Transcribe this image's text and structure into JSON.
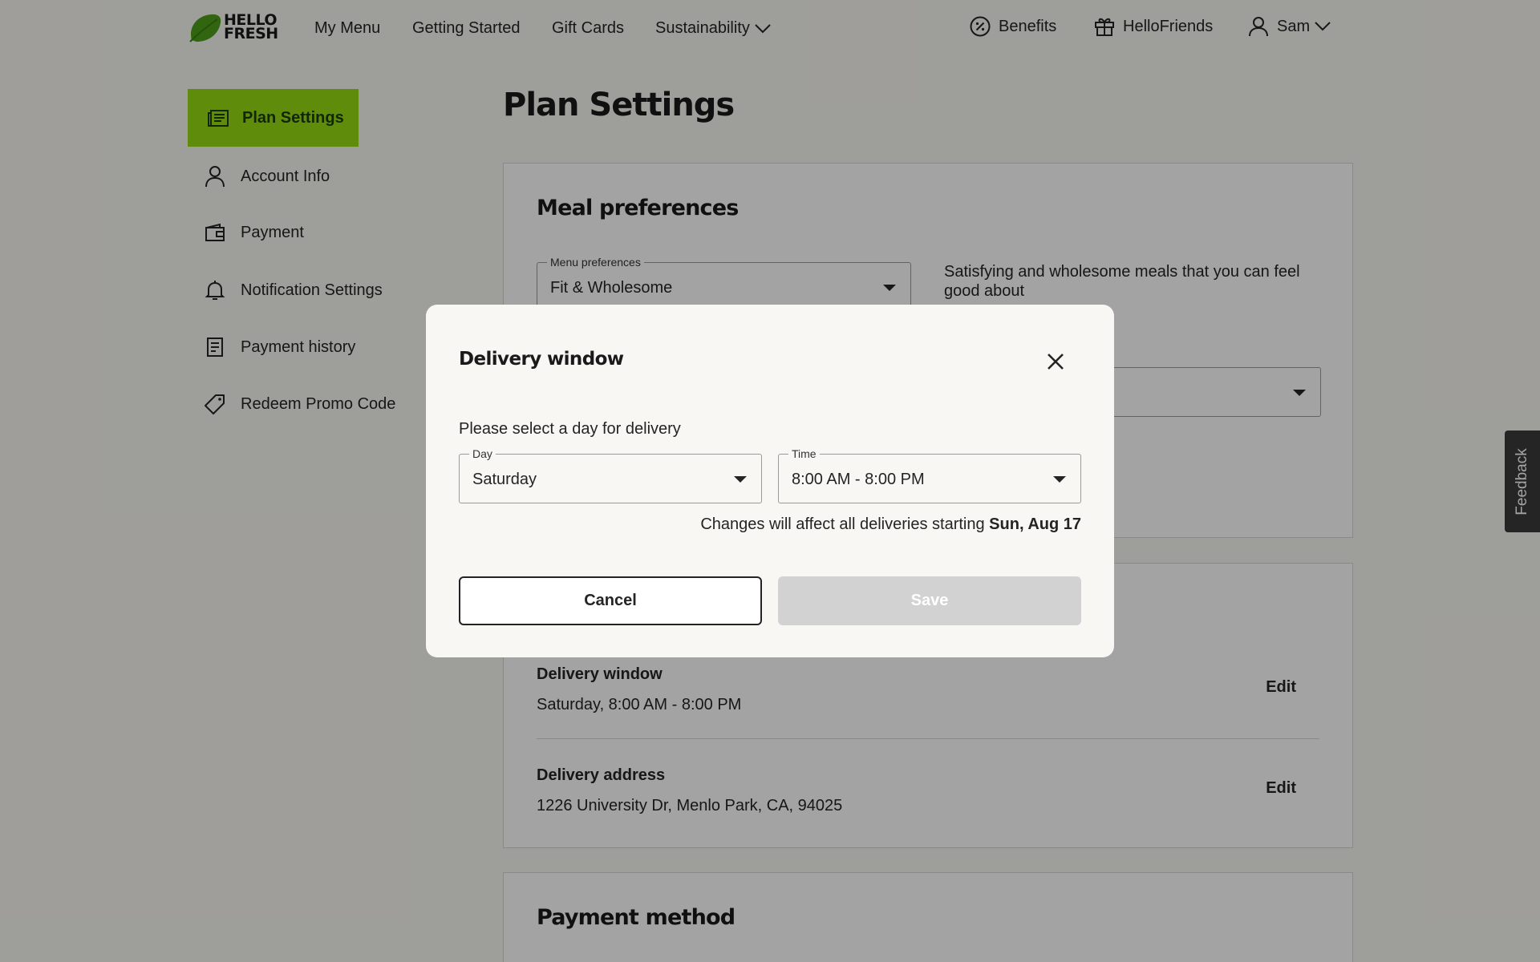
{
  "header": {
    "logo_line1": "HELLO",
    "logo_line2": "FRESH",
    "nav": [
      "My Menu",
      "Getting Started",
      "Gift Cards",
      "Sustainability"
    ],
    "benefits": "Benefits",
    "hellofriends": "HelloFriends",
    "user": "Sam"
  },
  "sidebar": {
    "active": "Plan Settings",
    "items": [
      "Account Info",
      "Payment",
      "Notification Settings",
      "Payment history",
      "Redeem Promo Code"
    ]
  },
  "main": {
    "title": "Plan Settings",
    "meal_card": {
      "title": "Meal preferences",
      "menu_pref_legend": "Menu preferences",
      "menu_pref_value": "Fit & Wholesome",
      "menu_pref_desc": "Satisfying and wholesome meals that you can feel good about"
    },
    "delivery_card": {
      "window_label": "Delivery window",
      "window_value": "Saturday, 8:00 AM - 8:00 PM",
      "address_label": "Delivery address",
      "address_value": "1226 University Dr, Menlo Park, CA, 94025",
      "edit": "Edit"
    },
    "payment_card": {
      "title": "Payment method"
    }
  },
  "feedback": "Feedback",
  "modal": {
    "title": "Delivery window",
    "prompt": "Please select a day for delivery",
    "day_legend": "Day",
    "day_value": "Saturday",
    "time_legend": "Time",
    "time_value": "8:00 AM - 8:00 PM",
    "notice_prefix": "Changes will affect all deliveries starting",
    "notice_date": "Sun, Aug 17",
    "cancel": "Cancel",
    "save": "Save"
  },
  "colors": {
    "brand_green": "#96dc14",
    "overlay": "rgba(0,0,0,0.36)",
    "save_disabled": "#d2d2d2"
  }
}
